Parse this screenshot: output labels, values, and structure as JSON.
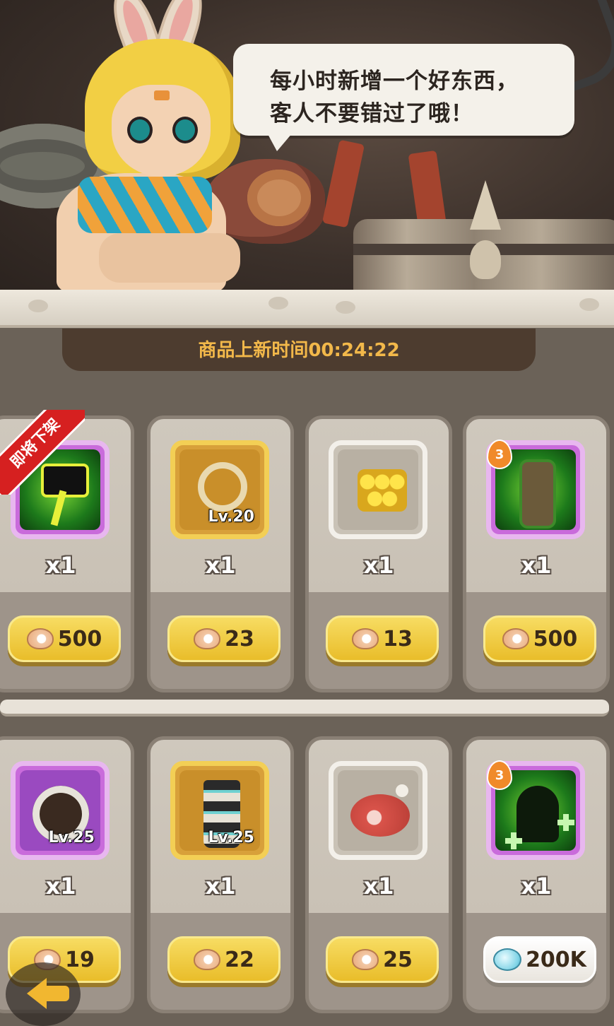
{
  "dialog": {
    "line1": "每小时新增一个好东西，",
    "line2": "客人不要错过了哦！"
  },
  "timer": {
    "label": "商品上新时间00:24:22"
  },
  "ribbon": {
    "text": "即将下架"
  },
  "items": [
    {
      "name": "green-dash-skill",
      "qty": "x1",
      "price": "500",
      "currency": "pearl",
      "level": "",
      "badge": ""
    },
    {
      "name": "bone-necklace",
      "qty": "x1",
      "price": "23",
      "currency": "pearl",
      "level": "Lv.20",
      "badge": ""
    },
    {
      "name": "honeycomb",
      "qty": "x1",
      "price": "13",
      "currency": "pearl",
      "level": "",
      "badge": ""
    },
    {
      "name": "green-totem-skill",
      "qty": "x1",
      "price": "500",
      "currency": "pearl",
      "level": "",
      "badge": "3"
    },
    {
      "name": "bone-ring-shield",
      "qty": "x1",
      "price": "19",
      "currency": "pearl",
      "level": "Lv.25",
      "badge": ""
    },
    {
      "name": "striped-boot",
      "qty": "x1",
      "price": "22",
      "currency": "pearl",
      "level": "Lv.25",
      "badge": ""
    },
    {
      "name": "ham-meat",
      "qty": "x1",
      "price": "25",
      "currency": "pearl",
      "level": "",
      "badge": ""
    },
    {
      "name": "green-heal-skill",
      "qty": "x1",
      "price": "200K",
      "currency": "gem",
      "level": "",
      "badge": "3"
    }
  ],
  "colors": {
    "price_button": "#f2cf45",
    "timer_text": "#f2b84a",
    "ribbon": "#d62020"
  },
  "icons": {
    "back": "back-arrow-icon",
    "pearl": "pearl-shell-icon",
    "gem": "blue-gem-icon"
  }
}
